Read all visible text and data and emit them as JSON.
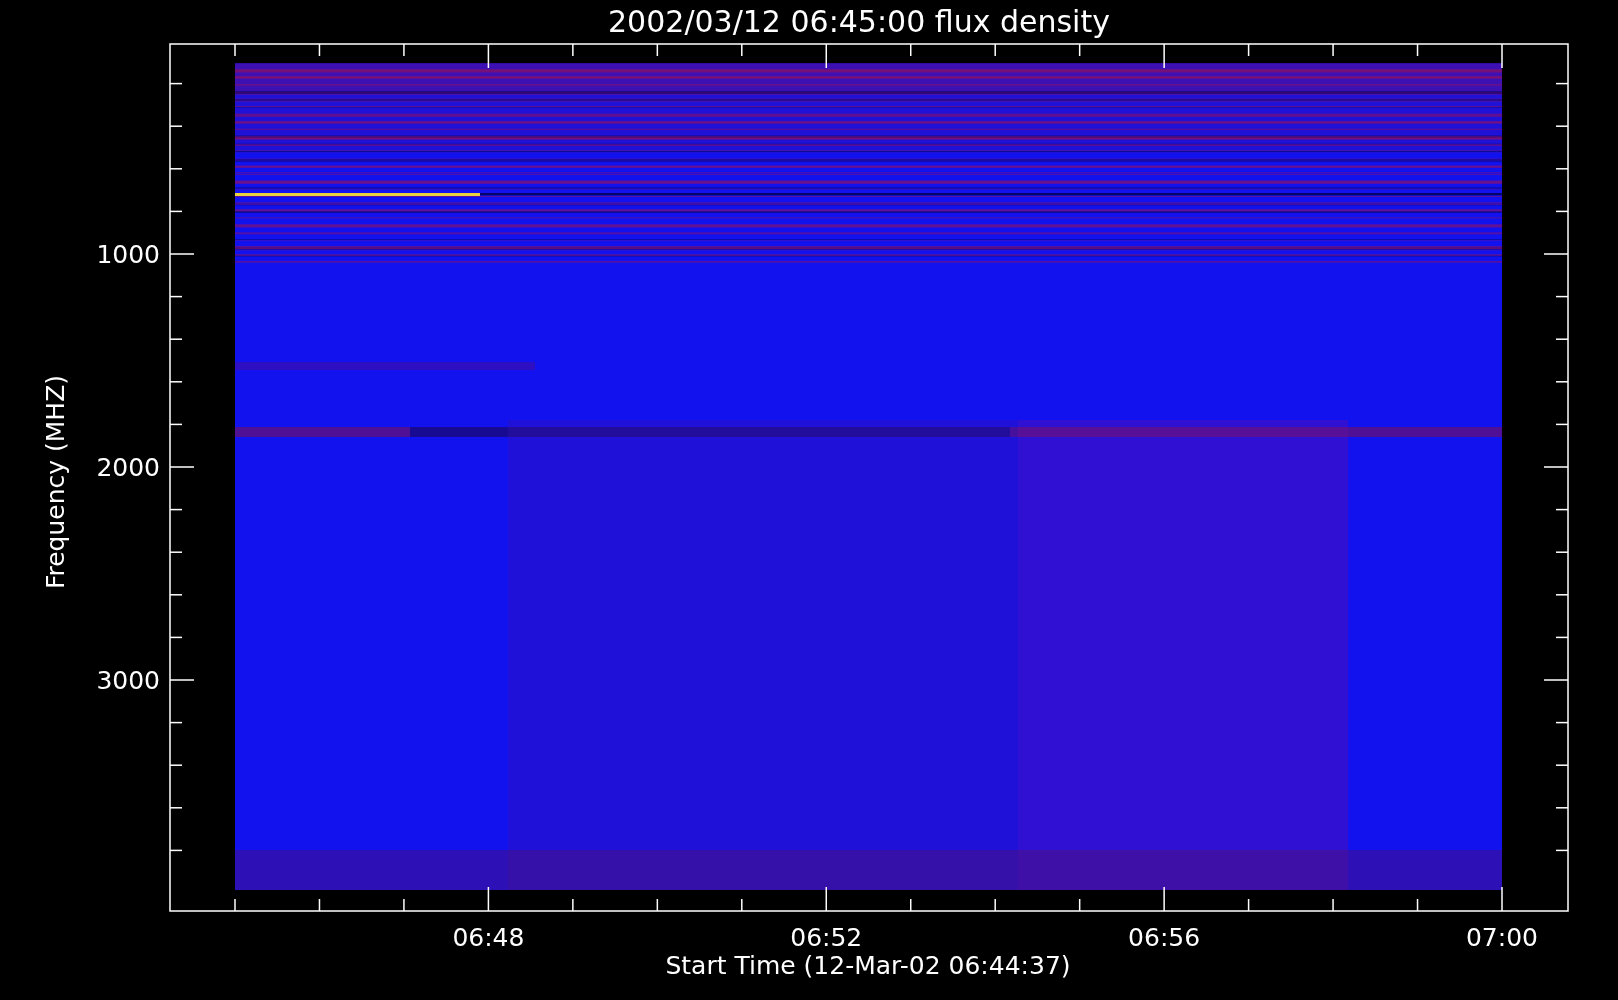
{
  "title": "2002/03/12 06:45:00 flux density",
  "ylabel": "Frequency (MHZ)",
  "xlabel": "Start Time (12-Mar-02 06:44:37)",
  "yticks": [
    "1000",
    "2000",
    "3000"
  ],
  "xticks": [
    "06:48",
    "06:52",
    "06:56",
    "07:00"
  ]
}
